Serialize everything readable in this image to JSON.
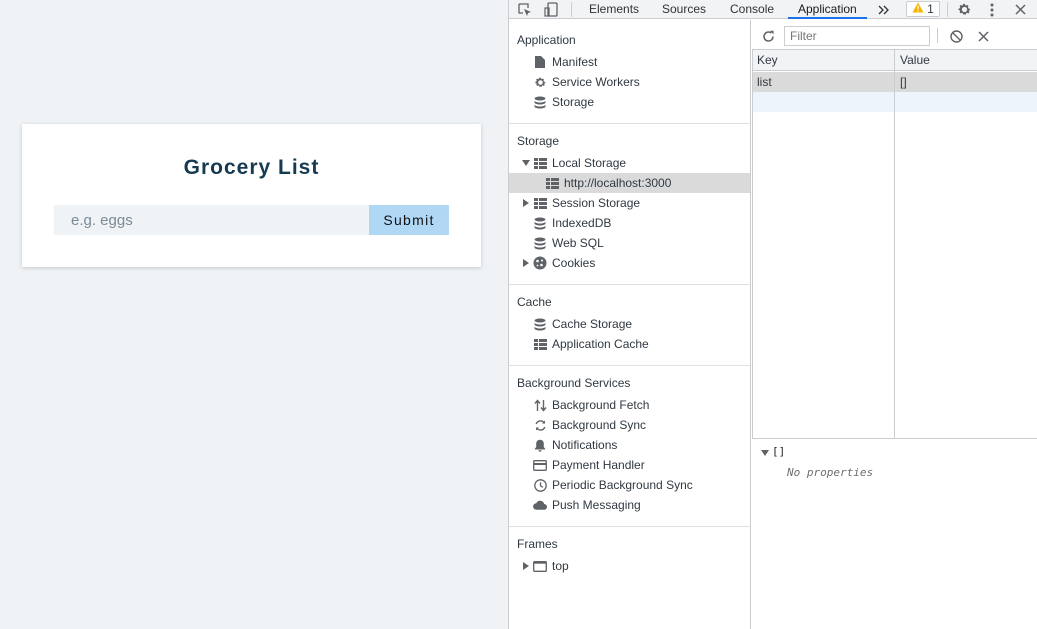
{
  "app": {
    "title": "Grocery List",
    "input_placeholder": "e.g. eggs",
    "submit_label": "Submit"
  },
  "devtools": {
    "tabs": [
      "Elements",
      "Sources",
      "Console",
      "Application"
    ],
    "active_tab": "Application",
    "warning_count": "1",
    "icons": {
      "inspect": "inspect-element-icon",
      "device": "device-toolbar-icon",
      "more_tabs": "chevron-double-right-icon",
      "warning": "warning-icon",
      "settings": "gear-icon",
      "menu": "kebab-menu-icon",
      "close": "close-icon"
    },
    "sidebar": {
      "application": {
        "title": "Application",
        "items": [
          "Manifest",
          "Service Workers",
          "Storage"
        ]
      },
      "storage": {
        "title": "Storage",
        "local_storage": "Local Storage",
        "local_origin": "http://localhost:3000",
        "session_storage": "Session Storage",
        "indexeddb": "IndexedDB",
        "websql": "Web SQL",
        "cookies": "Cookies"
      },
      "cache": {
        "title": "Cache",
        "items": [
          "Cache Storage",
          "Application Cache"
        ]
      },
      "background": {
        "title": "Background Services",
        "items": [
          "Background Fetch",
          "Background Sync",
          "Notifications",
          "Payment Handler",
          "Periodic Background Sync",
          "Push Messaging"
        ]
      },
      "frames": {
        "title": "Frames",
        "items": [
          "top"
        ]
      }
    },
    "filter_placeholder": "Filter",
    "grid": {
      "headers": [
        "Key",
        "Value"
      ],
      "rows": [
        {
          "key": "list",
          "value": "[]"
        }
      ]
    },
    "preview": {
      "value": "[]",
      "empty_text": "No properties"
    },
    "colors": {
      "accent": "#1a73e8",
      "selected_row": "#dadada",
      "button": "#b0d8f5",
      "title": "#163a52"
    }
  }
}
